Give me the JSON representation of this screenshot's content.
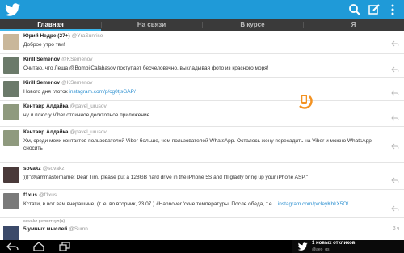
{
  "tabs": [
    {
      "label": "Главная",
      "active": true
    },
    {
      "label": "На связи",
      "active": false
    },
    {
      "label": "В курсе",
      "active": false
    },
    {
      "label": "Я",
      "active": false
    }
  ],
  "colors": {
    "accent": "#1f9ad8",
    "tab_bg": "#3a3a3a",
    "link": "#2b8fd0",
    "center_icon": "#f39222"
  },
  "actions": {
    "search_icon": "search-icon",
    "compose_icon": "compose-icon",
    "menu_icon": "overflow-menu-icon"
  },
  "tweets": [
    {
      "name": "Юрий Недре (27+)",
      "handle": "@YraSunrise",
      "text": "Доброе утро тви!",
      "link": ""
    },
    {
      "name": "Kirill Semenov",
      "handle": "@KSemenov",
      "text": "Считаю, что Леша @BombilCalabasov поступает бесчеловечно, выкладывая фото из красного моря!",
      "link": ""
    },
    {
      "name": "Kirill Semenov",
      "handle": "@KSemenov",
      "text": "Нового дня глоток ",
      "link": "instagram.com/p/cg0tjsGAP/"
    },
    {
      "name": "Кентавр Алдайка",
      "handle": "@pavel_urusov",
      "text": "ну и плюс у Viber отличное десктопное приложение",
      "link": ""
    },
    {
      "name": "Кентавр Алдайка",
      "handle": "@pavel_urusov",
      "text": "Хм, среди моих контактов пользователей Viber больше, чем пользователей WhatsApp. Осталось жену пересадить на Viber и можно WhatsApp сносить",
      "link": ""
    },
    {
      "name": "sovakz",
      "handle": "@sovakz",
      "text": ")))\"@jammastername: Dear Tim, please put a 128GB hard drive in the iPhone 5S and I'll gladly bring up your iPhone ASP.\"",
      "link": ""
    },
    {
      "name": "f1xus",
      "handle": "@f1xus",
      "text": "Кстати, в вот вам вчерашние, (т. е. во вторник, 23.07.) #Hannover 'ские температуры. После обеда, т.е... ",
      "link": "instagram.com/p/cleyKbkX5O/"
    },
    {
      "retweeted_by": "sovakz ретвитнул(а)",
      "name": "5 умных мыслей",
      "handle": "@Sumn",
      "text": "",
      "link": "",
      "time": "3 ч"
    }
  ],
  "notification": {
    "title": "1 новых откликов",
    "sub": "@aeo_gs"
  }
}
